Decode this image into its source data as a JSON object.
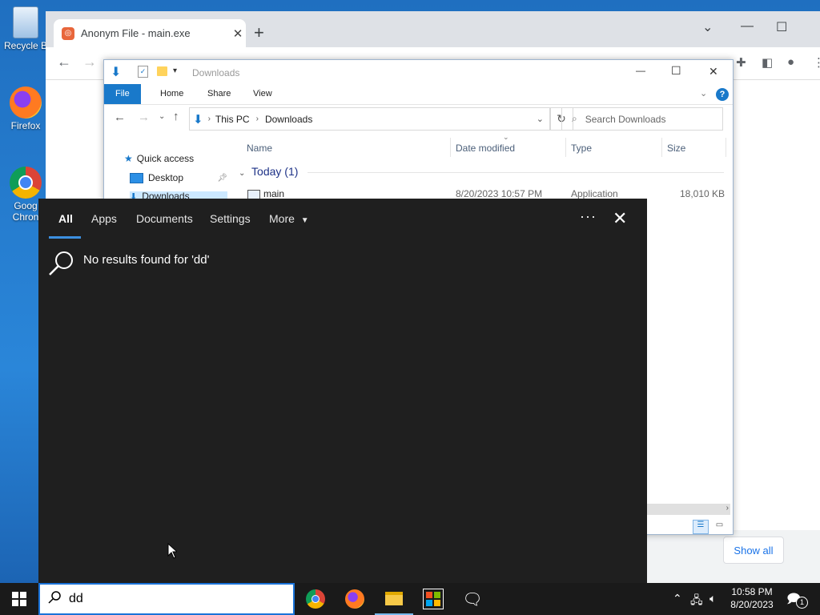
{
  "desktop": {
    "icons": [
      {
        "label": "Recycle B",
        "icon": "recycle-bin-icon"
      },
      {
        "label": "Firefox",
        "icon": "firefox-icon"
      },
      {
        "label": "Goog\nChron",
        "label_line1": "Goog",
        "label_line2": "Chron",
        "icon": "chrome-icon"
      }
    ]
  },
  "browser": {
    "tab_title": "Anonym File - main.exe",
    "show_all_label": "Show all"
  },
  "explorer": {
    "title": "Downloads",
    "ribbon_tabs": [
      "File",
      "Home",
      "Share",
      "View"
    ],
    "breadcrumb": [
      "This PC",
      "Downloads"
    ],
    "search_placeholder": "Search Downloads",
    "nav": {
      "quick_access": "Quick access",
      "desktop": "Desktop",
      "downloads": "Downloads"
    },
    "columns": {
      "name": "Name",
      "date": "Date modified",
      "type": "Type",
      "size": "Size"
    },
    "group_label": "Today (1)",
    "files": [
      {
        "name": "main",
        "date": "8/20/2023 10:57 PM",
        "type": "Application",
        "size": "18,010 KB"
      }
    ]
  },
  "search_flyout": {
    "tabs": [
      "All",
      "Apps",
      "Documents",
      "Settings",
      "More"
    ],
    "active_tab": "All",
    "no_results": "No results found for 'dd'"
  },
  "taskbar": {
    "search_value": "dd",
    "time": "10:58 PM",
    "date": "8/20/2023",
    "apps": [
      "chrome-icon",
      "firefox-icon",
      "file-explorer-icon",
      "store-icon",
      "feedback-hub-icon"
    ],
    "notification_count": "1"
  },
  "colors": {
    "accent": "#1979ca",
    "flyout_bg": "#1f1f1f",
    "taskbar_bg": "#1a1a1a",
    "desktop": "#2a86d9"
  }
}
